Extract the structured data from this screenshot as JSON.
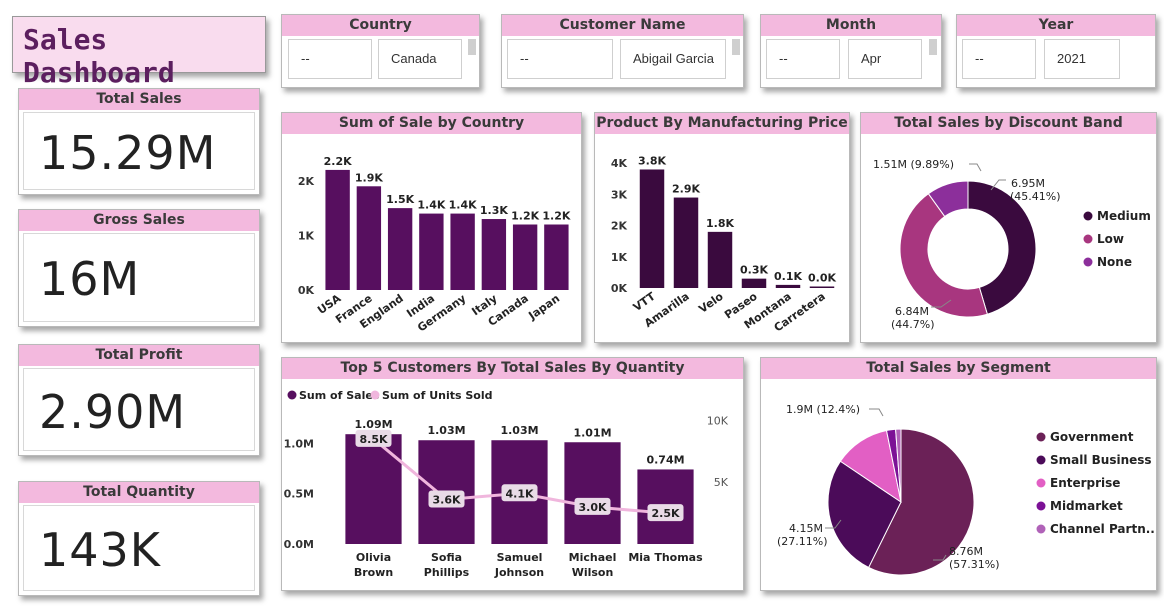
{
  "title": "Sales Dashboard",
  "kpis": [
    {
      "label": "Total Sales",
      "value": "15.29M"
    },
    {
      "label": "Gross Sales",
      "value": "16M"
    },
    {
      "label": "Total Profit",
      "value": "2.90M"
    },
    {
      "label": "Total Quantity",
      "value": "143K"
    }
  ],
  "slicers": {
    "country": {
      "label": "Country",
      "items": [
        "--",
        "Canada"
      ]
    },
    "customer": {
      "label": "Customer Name",
      "items": [
        "--",
        "Abigail Garcia"
      ]
    },
    "month": {
      "label": "Month",
      "items": [
        "--",
        "Apr"
      ]
    },
    "year": {
      "label": "Year",
      "items": [
        "--",
        "2021"
      ]
    }
  },
  "colors": {
    "accent": "#f3b9de",
    "dark": "#570f5f",
    "darkest": "#3a0a3e",
    "line": "#f0b6dd"
  },
  "chart_data": [
    {
      "type": "bar",
      "title": "Sum of Sale by Country",
      "categories": [
        "USA",
        "France",
        "England",
        "India",
        "Germany",
        "Italy",
        "Canada",
        "Japan"
      ],
      "values": [
        2200,
        1900,
        1500,
        1400,
        1400,
        1300,
        1200,
        1200
      ],
      "data_labels": [
        "2.2K",
        "1.9K",
        "1.5K",
        "1.4K",
        "1.4K",
        "1.3K",
        "1.2K",
        "1.2K"
      ],
      "yticks": [
        0,
        1000,
        2000
      ],
      "ytick_labels": [
        "0K",
        "1K",
        "2K"
      ],
      "ylim": [
        0,
        2400
      ],
      "color": "#570f5f"
    },
    {
      "type": "bar",
      "title": "Product By Manufacturing Price",
      "categories": [
        "VTT",
        "Amarilla",
        "Velo",
        "Paseo",
        "Montana",
        "Carretera"
      ],
      "values": [
        3800,
        2900,
        1800,
        300,
        100,
        0
      ],
      "data_labels": [
        "3.8K",
        "2.9K",
        "1.8K",
        "0.3K",
        "0.1K",
        "0.0K"
      ],
      "yticks": [
        0,
        1000,
        2000,
        3000,
        4000
      ],
      "ytick_labels": [
        "0K",
        "1K",
        "2K",
        "3K",
        "4K"
      ],
      "ylim": [
        0,
        4200
      ],
      "color": "#3a0a3e"
    },
    {
      "type": "pie",
      "title": "Total Sales by Discount Band",
      "donut": true,
      "legend": "right",
      "slices": [
        {
          "name": "Medium",
          "label": "6.95M",
          "pct": "(45.41%)",
          "value": 45.41,
          "color": "#3a0a3e"
        },
        {
          "name": "Low",
          "label": "6.84M",
          "pct": "(44.7%)",
          "value": 44.7,
          "color": "#a8367f"
        },
        {
          "name": "None",
          "label": "1.51M (9.89%)",
          "pct": "",
          "value": 9.89,
          "color": "#8c2f9b"
        }
      ]
    },
    {
      "type": "bar",
      "title": "Top 5 Customers By Total Sales By Quantity",
      "legend": "top-left",
      "categories": [
        "Olivia Brown",
        "Sofia Phillips",
        "Samuel Johnson",
        "Michael Wilson",
        "Mia Thomas"
      ],
      "category_lines": [
        [
          "Olivia",
          "Brown"
        ],
        [
          "Sofia",
          "Phillips"
        ],
        [
          "Samuel",
          "Johnson"
        ],
        [
          "Michael",
          "Wilson"
        ],
        [
          "Mia Thomas"
        ]
      ],
      "series": [
        {
          "name": "Sum of Sales",
          "type": "bar",
          "values": [
            1.09,
            1.03,
            1.03,
            1.01,
            0.74
          ],
          "data_labels": [
            "1.09M",
            "1.03M",
            "1.03M",
            "1.01M",
            "0.74M"
          ],
          "color": "#570f5f"
        },
        {
          "name": "Sum of Units Sold",
          "type": "line",
          "values": [
            8500,
            3600,
            4100,
            3000,
            2500
          ],
          "data_labels": [
            "8.5K",
            "3.6K",
            "4.1K",
            "3.0K",
            "2.5K"
          ],
          "color": "#f0b6dd"
        }
      ],
      "yticks": [
        0,
        0.5,
        1.0
      ],
      "ytick_labels": [
        "0.0M",
        "0.5M",
        "1.0M"
      ],
      "ylim": [
        0,
        1.35
      ],
      "y2ticks": [
        5000,
        10000
      ],
      "y2tick_labels": [
        "5K",
        "10K"
      ],
      "y2lim": [
        0,
        11000
      ]
    },
    {
      "type": "pie",
      "title": "Total Sales by Segment",
      "legend": "right",
      "slices": [
        {
          "name": "Government",
          "label": "8.76M",
          "pct": "(57.31%)",
          "value": 57.31,
          "color": "#6b2157"
        },
        {
          "name": "Small Business",
          "label": "4.15M",
          "pct": "(27.11%)",
          "value": 27.11,
          "color": "#4b0b59"
        },
        {
          "name": "Enterprise",
          "label": "1.9M (12.4%)",
          "pct": "",
          "value": 12.4,
          "color": "#e25fc4"
        },
        {
          "name": "Midmarket",
          "label": "",
          "pct": "",
          "value": 2.0,
          "color": "#7c1196"
        },
        {
          "name": "Channel Partn...",
          "label": "",
          "pct": "",
          "value": 1.18,
          "color": "#b062b8"
        }
      ]
    }
  ]
}
